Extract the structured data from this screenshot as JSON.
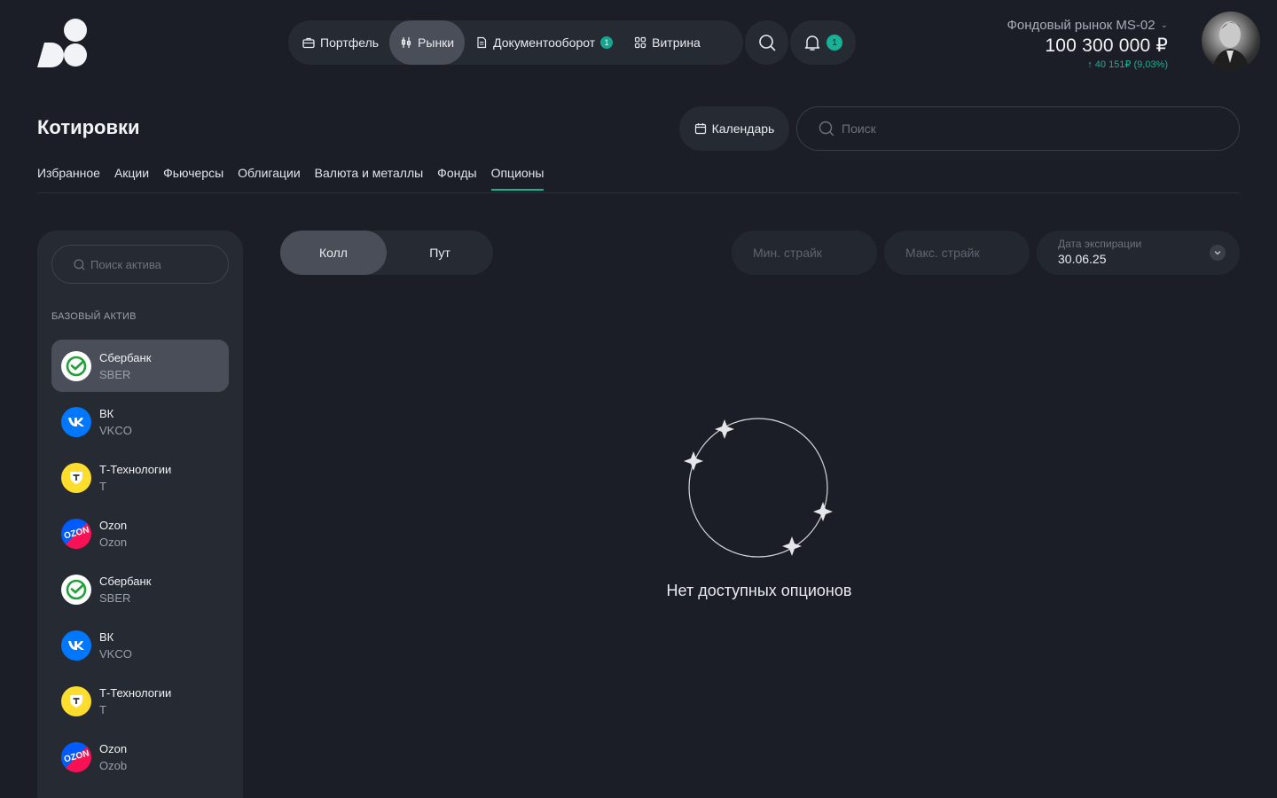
{
  "nav": {
    "items": [
      {
        "label": "Портфель",
        "icon": "briefcase-icon",
        "active": false
      },
      {
        "label": "Рынки",
        "icon": "candlestick-icon",
        "active": true
      },
      {
        "label": "Документооборот",
        "icon": "document-icon",
        "badge": "1"
      },
      {
        "label": "Витрина",
        "icon": "grid-icon"
      }
    ],
    "notifications_count": "1"
  },
  "account": {
    "name": "Фондовый рынок MS-02",
    "balance": "100 300 000 ₽",
    "change": "↑ 40 151₽ (9,03%)",
    "change_color": "#17b196"
  },
  "page": {
    "title": "Котировки",
    "calendar_label": "Календарь",
    "search_placeholder": "Поиск"
  },
  "tabs": [
    {
      "label": "Избранное"
    },
    {
      "label": "Акции"
    },
    {
      "label": "Фьючерсы"
    },
    {
      "label": "Облигации"
    },
    {
      "label": "Валюта и металлы"
    },
    {
      "label": "Фонды"
    },
    {
      "label": "Опционы",
      "active": true
    }
  ],
  "sidebar": {
    "search_placeholder": "Поиск актива",
    "heading": "БАЗОВЫЙ АКТИВ",
    "assets": [
      {
        "name": "Сбербанк",
        "ticker": "SBER",
        "logo": "sber"
      },
      {
        "name": "ВК",
        "ticker": "VKCO",
        "logo": "vk"
      },
      {
        "name": "Т-Технологии",
        "ticker": "T",
        "logo": "tbank"
      },
      {
        "name": "Ozon",
        "ticker": "Ozon",
        "logo": "ozon"
      },
      {
        "name": "Сбербанк",
        "ticker": "SBER",
        "logo": "sber"
      },
      {
        "name": "ВК",
        "ticker": "VKCO",
        "logo": "vk"
      },
      {
        "name": "Т-Технологии",
        "ticker": "T",
        "logo": "tbank"
      },
      {
        "name": "Ozon",
        "ticker": "Ozob",
        "logo": "ozon"
      }
    ]
  },
  "options": {
    "call_label": "Колл",
    "put_label": "Пут",
    "min_strike_placeholder": "Мин. страйк",
    "max_strike_placeholder": "Макс. страйк",
    "expiry_label": "Дата экспирации",
    "expiry_value": "30.06.25",
    "empty_text": "Нет доступных опционов"
  },
  "colors": {
    "accent": "#17b196",
    "background": "#1b1e26",
    "panel": "#262a33"
  }
}
